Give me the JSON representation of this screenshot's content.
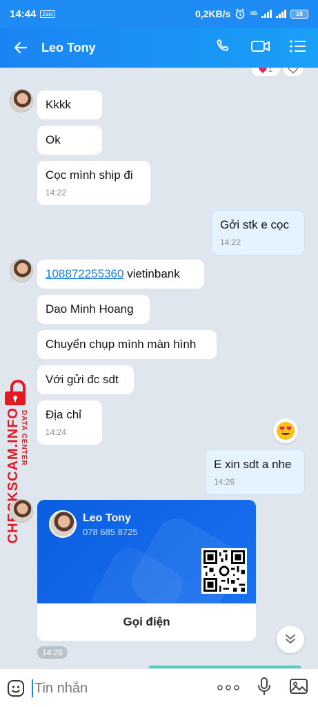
{
  "status_bar": {
    "time": "14:44",
    "zalo_mini": "Zalo",
    "speed": "0,2KB/s",
    "network": "4G",
    "battery": "18"
  },
  "header": {
    "contact_name": "Leo Tony"
  },
  "messages": [
    {
      "from": "them",
      "text": "Kkkk"
    },
    {
      "from": "them",
      "text": "Ok"
    },
    {
      "from": "them",
      "text": "Cọc mình ship đi",
      "time": "14:22"
    },
    {
      "from": "me",
      "text": "Gởi stk e cọc",
      "time": "14:22"
    },
    {
      "from": "them",
      "link": "108872255360",
      "text": " vietinbank"
    },
    {
      "from": "them",
      "text": "Dao Minh Hoang"
    },
    {
      "from": "them",
      "text": "Chuyển chụp mình màn hình"
    },
    {
      "from": "them",
      "text": "Với gửi đc sdt"
    },
    {
      "from": "them",
      "text": "Địa chỉ",
      "time": "14:24"
    },
    {
      "from": "me",
      "text": "E xin sdt a nhe",
      "time": "14:26"
    }
  ],
  "reaction_count": "1",
  "contact_card": {
    "name": "Leo Tony",
    "phone": "078 685 8725",
    "call_label": "Gọi điện",
    "time": "14:26"
  },
  "watermark": {
    "main": "CHECKSCAM.INFO",
    "sub": "DATA CENTER"
  },
  "input": {
    "placeholder": "Tin nhắn"
  },
  "colors": {
    "header": "#1b84f4",
    "my_bubble": "#e5f3ff",
    "card_blue": "#0a5fe0",
    "watermark": "#e21a24"
  }
}
